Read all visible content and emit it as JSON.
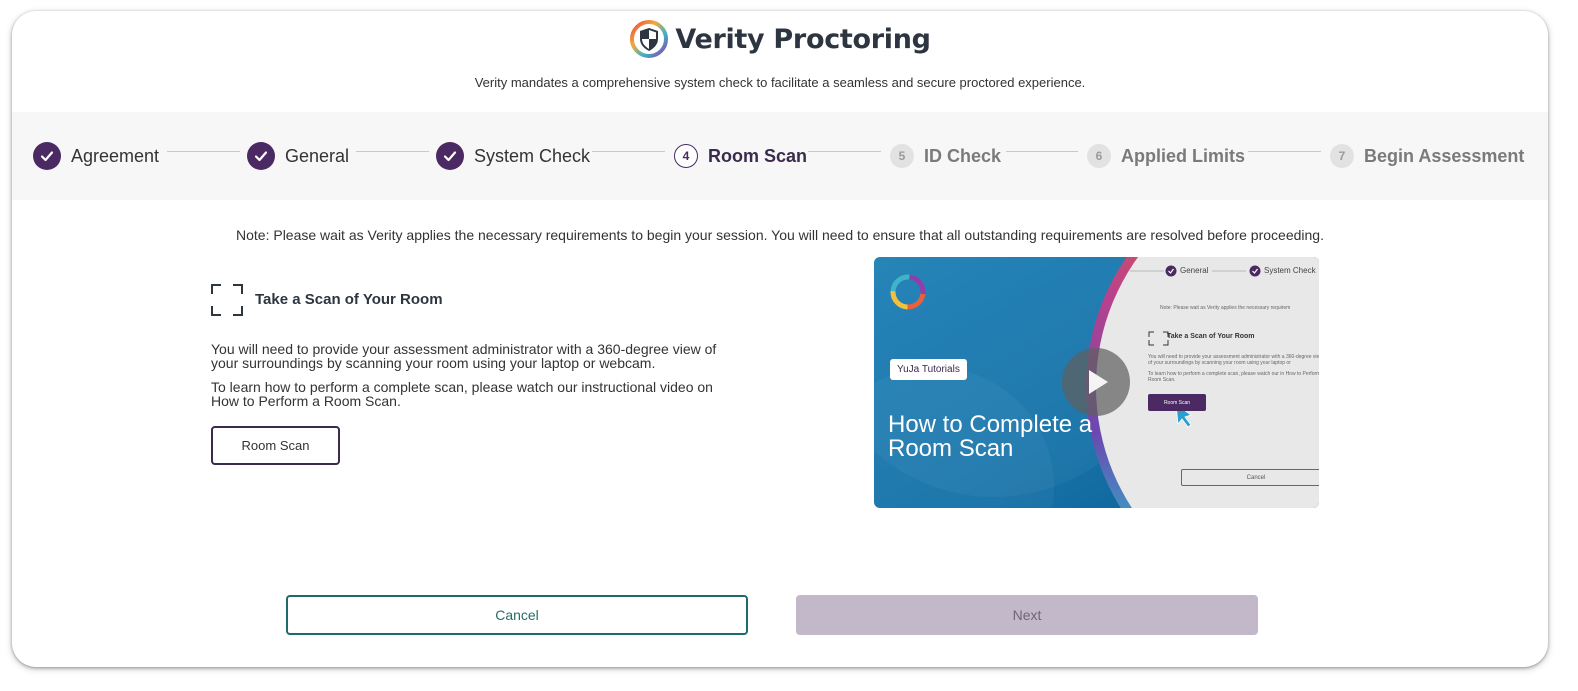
{
  "header": {
    "title": "Verity Proctoring",
    "subtitle": "Verity mandates a comprehensive system check to facilitate a seamless and secure proctored experience."
  },
  "steps": [
    {
      "label": "Agreement",
      "status": "complete"
    },
    {
      "label": "General",
      "status": "complete"
    },
    {
      "label": "System Check",
      "status": "complete"
    },
    {
      "number": "4",
      "label": "Room Scan",
      "status": "current"
    },
    {
      "number": "5",
      "label": "ID Check",
      "status": "upcoming"
    },
    {
      "number": "6",
      "label": "Applied Limits",
      "status": "upcoming"
    },
    {
      "number": "7",
      "label": "Begin Assessment",
      "status": "upcoming"
    }
  ],
  "note": "Note: Please wait as Verity applies the necessary requirements to begin your session. You will need to ensure that all outstanding requirements are resolved before proceeding.",
  "room_scan": {
    "icon": "scan-frame-icon",
    "title": "Take a Scan of Your Room",
    "paragraph1": "You will need to provide your assessment administrator with a 360-degree view of your surroundings by scanning your room using your laptop or webcam.",
    "paragraph2": "To learn how to perform a complete scan, please watch our instructional video on How to Perform a Room Scan.",
    "button_label": "Room Scan"
  },
  "video": {
    "badge": "YuJa Tutorials",
    "title": "How to Complete a Room Scan",
    "preview": {
      "step_general": "General",
      "step_system_check": "System Check",
      "note": "Note: Please wait as Verity applies the necessary requirem",
      "heading": "Take a Scan of Your Room",
      "text1": "You will need to provide your assessment administrator with a 360-degree view of your surroundings by scanning your room using your laptop or",
      "text2": "To learn how to perform a complete scan, please watch our in How to Perform a Room Scan.",
      "button": "Room Scan",
      "cancel": "Cancel"
    }
  },
  "footer": {
    "cancel_label": "Cancel",
    "next_label": "Next"
  },
  "colors": {
    "primary": "#4b2a63",
    "teal": "#1e6b69",
    "disabled": "#c2b8ca"
  }
}
